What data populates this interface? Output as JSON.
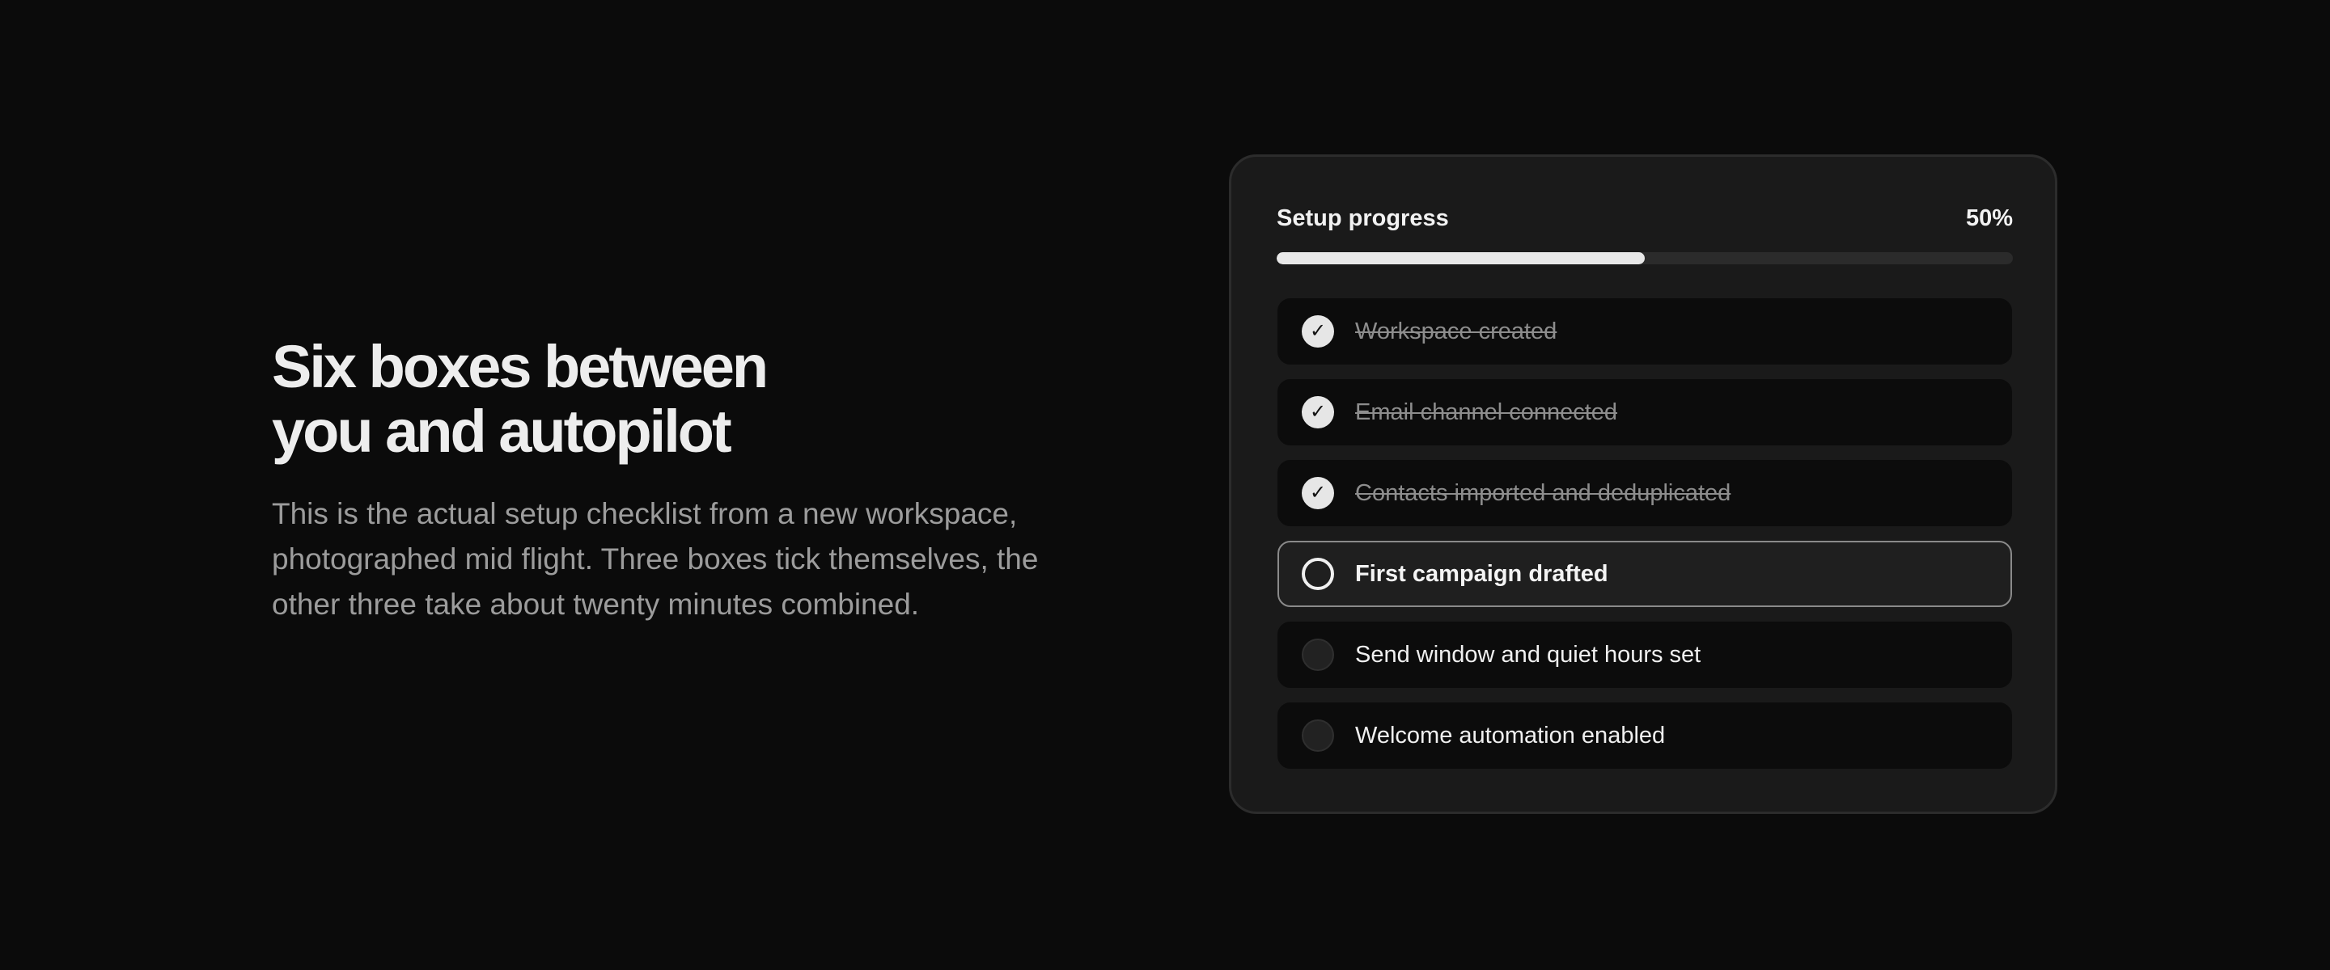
{
  "intro": {
    "heading_line_1": "Six boxes between",
    "heading_line_2": "you and autopilot",
    "body": "This is the actual setup checklist from a new workspace, photographed mid flight. Three boxes tick themselves, the other three take about twenty minutes combined."
  },
  "card": {
    "title": "Setup progress",
    "percent_label": "50%",
    "progress_fraction": 0.5,
    "items": [
      {
        "label": "Workspace created",
        "state": "done",
        "check_glyph": "✓",
        "icon": "check-icon"
      },
      {
        "label": "Email channel connected",
        "state": "done",
        "check_glyph": "✓",
        "icon": "check-icon"
      },
      {
        "label": "Contacts imported and deduplicated",
        "state": "done",
        "check_glyph": "✓",
        "icon": "check-icon"
      },
      {
        "label": "First campaign drafted",
        "state": "active",
        "check_glyph": "",
        "icon": "circle-outline-icon"
      },
      {
        "label": "Send window and quiet hours set",
        "state": "pending",
        "check_glyph": "",
        "icon": "circle-icon"
      },
      {
        "label": "Welcome automation enabled",
        "state": "pending",
        "check_glyph": "",
        "icon": "circle-icon"
      }
    ]
  }
}
